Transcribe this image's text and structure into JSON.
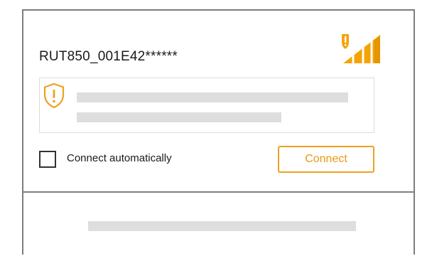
{
  "network": {
    "ssid": "RUT850_001E42******",
    "signal_icon": "signal-strength-shield-icon",
    "warning_icon": "shield-warning-icon"
  },
  "controls": {
    "auto_connect_label": "Connect automatically",
    "auto_connect_checked": false,
    "connect_label": "Connect"
  },
  "colors": {
    "accent": "#f0a020",
    "border": "#7d7d7d",
    "placeholder": "#dedede"
  }
}
